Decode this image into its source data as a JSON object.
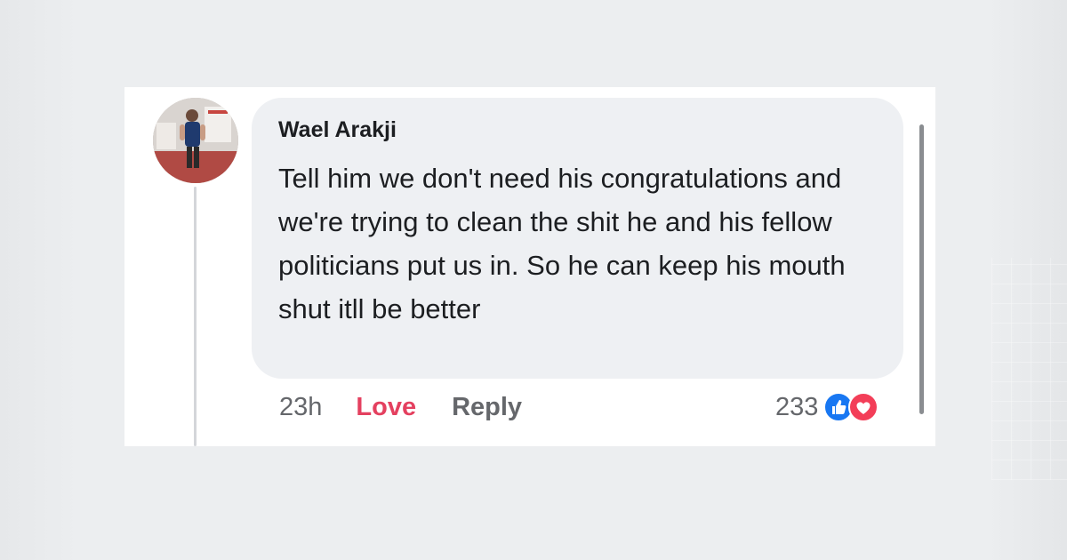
{
  "comment": {
    "author": "Wael Arakji",
    "text": "Tell him we don't need his congratulations and we're trying to clean the shit he and his fellow politicians put us in. So he can keep his mouth shut itll be better",
    "timestamp": "23h",
    "reaction_count": "233"
  },
  "actions": {
    "love_label": "Love",
    "reply_label": "Reply"
  },
  "icons": {
    "like": "thumbs-up-icon",
    "love": "heart-icon"
  },
  "colors": {
    "like_blue": "#1877f2",
    "love_red": "#f33e58",
    "love_text": "#e4405f",
    "bubble": "#eef0f3"
  }
}
